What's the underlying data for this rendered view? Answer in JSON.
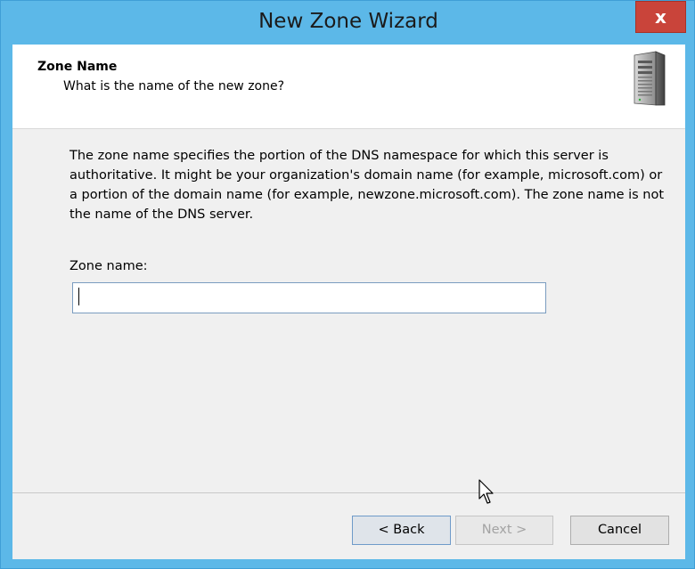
{
  "window": {
    "title": "New Zone Wizard",
    "close_glyph": "x"
  },
  "header": {
    "title": "Zone Name",
    "subtitle": "What is the name of the new zone?",
    "icon": "server-icon"
  },
  "body": {
    "description": "The zone name specifies the portion of the DNS namespace for which this server is authoritative. It might be your organization's domain name (for example, microsoft.com) or a portion of the domain name (for example, newzone.microsoft.com). The zone name is not the name of the DNS server.",
    "zone_name_label": "Zone name:",
    "zone_name_value": ""
  },
  "buttons": {
    "back": "< Back",
    "next": "Next >",
    "cancel": "Cancel"
  },
  "colors": {
    "titlebar": "#5cb8e8",
    "close": "#c9443a"
  }
}
